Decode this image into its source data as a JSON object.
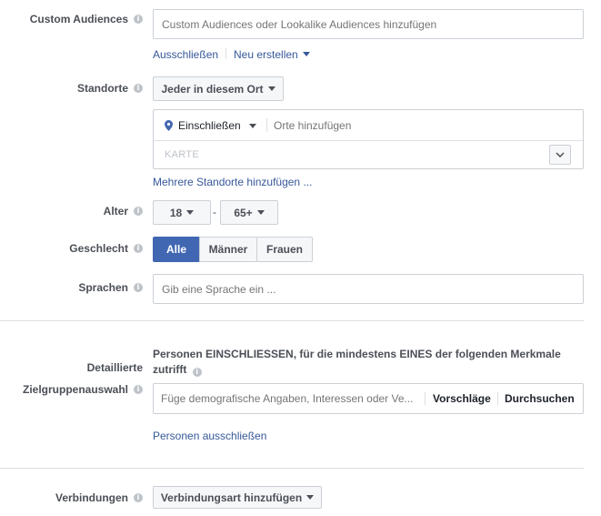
{
  "custom_audiences": {
    "label": "Custom Audiences",
    "placeholder": "Custom Audiences oder Lookalike Audiences hinzufügen",
    "exclude_link": "Ausschließen",
    "create_new_link": "Neu erstellen"
  },
  "locations": {
    "label": "Standorte",
    "scope_value": "Jeder in diesem Ort",
    "include_value": "Einschließen",
    "add_placeholder": "Orte hinzufügen",
    "map_label": "KARTE",
    "add_multiple_link": "Mehrere Standorte hinzufügen ..."
  },
  "age": {
    "label": "Alter",
    "min_value": "18",
    "separator": "-",
    "max_value": "65+"
  },
  "gender": {
    "label": "Geschlecht",
    "options": [
      "Alle",
      "Männer",
      "Frauen"
    ],
    "selected": "Alle",
    "accent": "#4267b2"
  },
  "languages": {
    "label": "Sprachen",
    "placeholder": "Gib eine Sprache ein ..."
  },
  "detailed_targeting": {
    "label_line1": "Detaillierte",
    "label_line2": "Zielgruppenauswahl",
    "description_line1": "Personen EINSCHLIESSEN, für die mindestens EINES der folgenden Merkmale",
    "description_line2": "zutrifft",
    "placeholder": "Füge demografische Angaben, Interessen oder Ve...",
    "suggestions_label": "Vorschläge",
    "browse_label": "Durchsuchen",
    "exclude_link": "Personen ausschließen"
  },
  "connections": {
    "label": "Verbindungen",
    "button_label": "Verbindungsart hinzufügen"
  },
  "icons": {
    "info": "info-icon",
    "location_pin": "location-pin-icon",
    "dropdown": "chevron-down-icon"
  }
}
